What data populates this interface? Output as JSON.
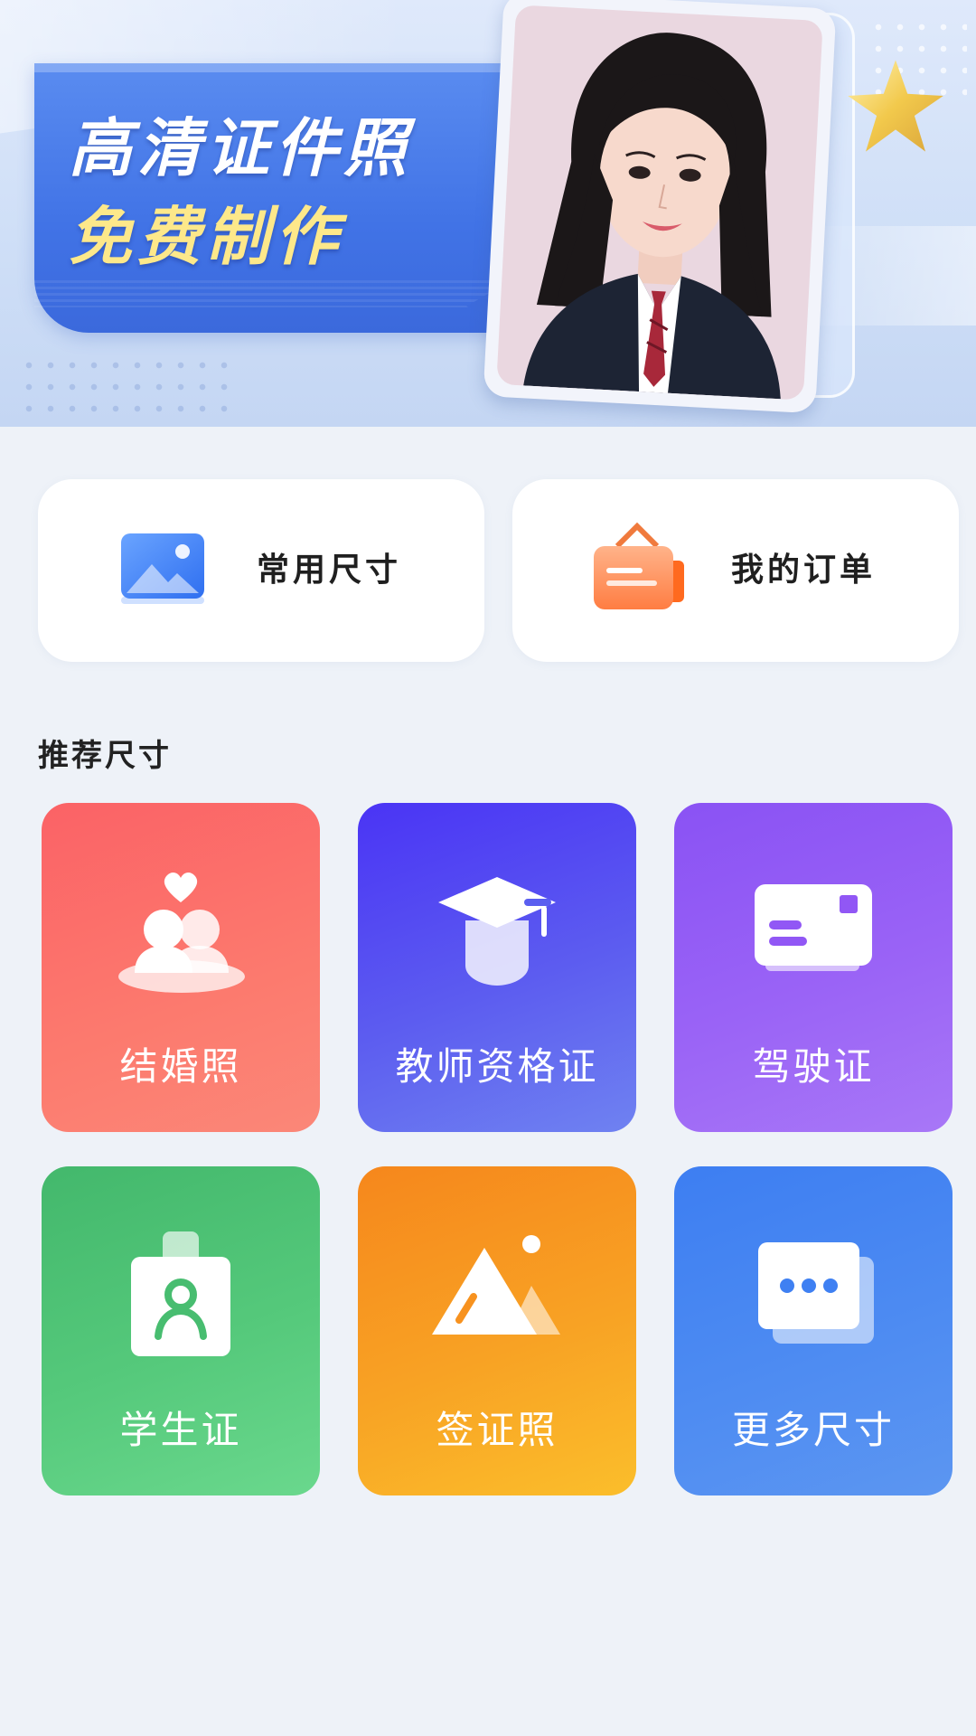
{
  "banner": {
    "headline_line1": "高清证件照",
    "headline_line2": "免费制作",
    "accent_color": "#fde88a",
    "ribbon_color": "#4173e6"
  },
  "quick_actions": [
    {
      "label": "常用尺寸",
      "icon": "image-icon"
    },
    {
      "label": "我的订单",
      "icon": "order-bag-icon"
    }
  ],
  "section": {
    "title": "推荐尺寸"
  },
  "tiles": [
    {
      "label": "结婚照",
      "icon": "couple-heart-icon",
      "color": "#fb6266"
    },
    {
      "label": "教师资格证",
      "icon": "graduation-cap-icon",
      "color": "#4a34f5"
    },
    {
      "label": "驾驶证",
      "icon": "license-card-icon",
      "color": "#8a52f4"
    },
    {
      "label": "学生证",
      "icon": "student-badge-icon",
      "color": "#43b86c"
    },
    {
      "label": "签证照",
      "icon": "mountain-image-icon",
      "color": "#f6871c"
    },
    {
      "label": "更多尺寸",
      "icon": "more-dots-icon",
      "color": "#3d7ef2"
    }
  ]
}
